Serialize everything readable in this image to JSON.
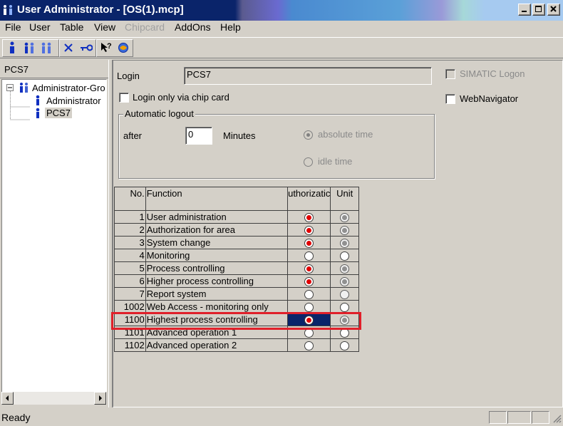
{
  "window": {
    "title": "User Administrator - [OS(1).mcp]",
    "title_bar_color": "#0a246a",
    "buttons": {
      "minimize_icon": "minimize-icon",
      "maximize_icon": "maximize-icon",
      "close_icon": "close-icon"
    }
  },
  "menu": {
    "items": [
      "File",
      "User",
      "Table",
      "View",
      "Chipcard",
      "AddOns",
      "Help"
    ],
    "disabled": [
      "Chipcard"
    ]
  },
  "toolbar": {
    "icons": [
      "new-user-icon",
      "new-group-icon",
      "multi-user-icon",
      "delete-icon",
      "key-icon",
      "help-icon",
      "web-icon"
    ]
  },
  "left": {
    "header": "PCS7",
    "tree": {
      "root": "Administrator-Gro",
      "children": [
        "Administrator",
        "PCS7"
      ],
      "selected": "PCS7"
    }
  },
  "form": {
    "login_label": "Login",
    "login_value": "PCS7",
    "chip_card_label": "Login only via chip card",
    "simatic_logon_label": "SIMATIC Logon",
    "web_navigator_label": "WebNavigator",
    "auto_logout": {
      "legend": "Automatic logout",
      "after_label": "after",
      "after_value": "0",
      "minutes_label": "Minutes",
      "absolute_time_label": "absolute time",
      "idle_time_label": "idle time"
    }
  },
  "table": {
    "headers": {
      "no": "No.",
      "function": "Function",
      "authorization": "uthorizatic",
      "unit": "Unit"
    },
    "accent_color": "#e00000",
    "selection_color": "#0a246a",
    "highlight_color": "#e0202a",
    "rows": [
      {
        "no": "1",
        "function": "User administration",
        "auth": true,
        "unit": true,
        "unit_dim": true
      },
      {
        "no": "2",
        "function": "Authorization for area",
        "auth": true,
        "unit": true,
        "unit_dim": true
      },
      {
        "no": "3",
        "function": "System change",
        "auth": true,
        "unit": true,
        "unit_dim": true
      },
      {
        "no": "4",
        "function": "Monitoring",
        "auth": false,
        "unit": false,
        "unit_dim": false
      },
      {
        "no": "5",
        "function": "Process controlling",
        "auth": true,
        "unit": true,
        "unit_dim": true
      },
      {
        "no": "6",
        "function": "Higher process controlling",
        "auth": true,
        "unit": true,
        "unit_dim": true
      },
      {
        "no": "7",
        "function": "Report system",
        "auth": false,
        "unit": false,
        "unit_dim": true
      },
      {
        "no": "1002",
        "function": "Web Access - monitoring only",
        "auth": false,
        "unit": false,
        "unit_dim": false
      },
      {
        "no": "1100",
        "function": "Highest process controlling",
        "auth": true,
        "unit": true,
        "unit_dim": true,
        "selected": true
      },
      {
        "no": "1101",
        "function": "Advanced operation 1",
        "auth": false,
        "unit": false,
        "unit_dim": false
      },
      {
        "no": "1102",
        "function": "Advanced operation 2",
        "auth": false,
        "unit": false,
        "unit_dim": false
      }
    ]
  },
  "status": {
    "text": "Ready"
  }
}
